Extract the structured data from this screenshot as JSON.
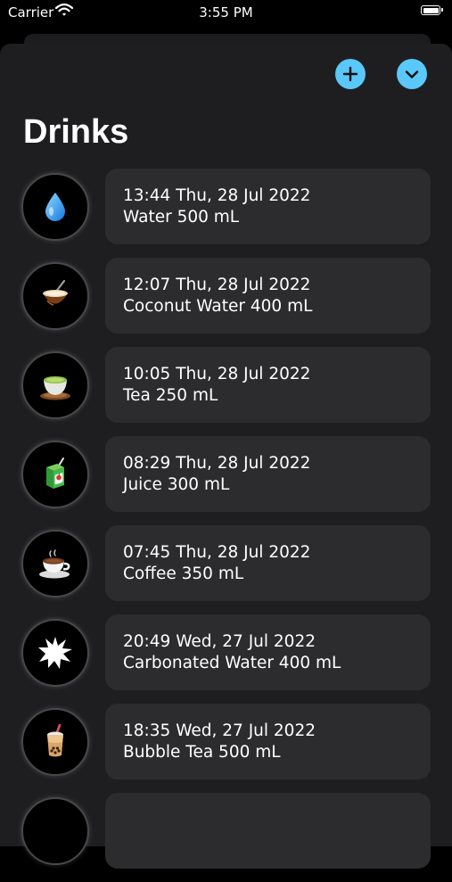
{
  "status_bar": {
    "carrier": "Carrier",
    "time": "3:55 PM"
  },
  "header": {
    "title": "Drinks",
    "add_icon": "plus-icon",
    "collapse_icon": "chevron-down-icon",
    "accent_color": "#5ac8fa"
  },
  "drinks": [
    {
      "datetime": "13:44 Thu, 28 Jul 2022",
      "summary": "Water 500 mL",
      "icon": "water-drop-icon"
    },
    {
      "datetime": "12:07 Thu, 28 Jul 2022",
      "summary": "Coconut Water 400 mL",
      "icon": "coconut-icon"
    },
    {
      "datetime": "10:05 Thu, 28 Jul 2022",
      "summary": "Tea 250 mL",
      "icon": "tea-cup-icon"
    },
    {
      "datetime": "08:29 Thu, 28 Jul 2022",
      "summary": "Juice 300 mL",
      "icon": "juice-box-icon"
    },
    {
      "datetime": "07:45 Thu, 28 Jul 2022",
      "summary": "Coffee 350 mL",
      "icon": "coffee-cup-icon"
    },
    {
      "datetime": "20:49 Wed, 27 Jul 2022",
      "summary": "Carbonated Water 400 mL",
      "icon": "burst-icon"
    },
    {
      "datetime": "18:35 Wed, 27 Jul 2022",
      "summary": "Bubble Tea 500 mL",
      "icon": "bubble-tea-icon"
    }
  ]
}
